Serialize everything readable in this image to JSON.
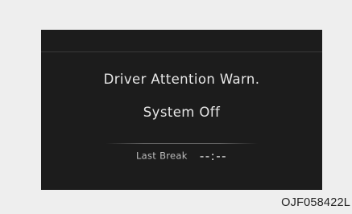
{
  "display": {
    "message_line1": "Driver Attention Warn.",
    "message_line2": "System Off",
    "last_break_label": "Last Break",
    "last_break_value": "--:--"
  },
  "figure_code": "OJF058422L",
  "colors": {
    "page_background": "#eeeeee",
    "screen_background": "#1c1c1c",
    "text_primary": "#e6e6e6",
    "text_secondary": "#bdbdbd"
  }
}
